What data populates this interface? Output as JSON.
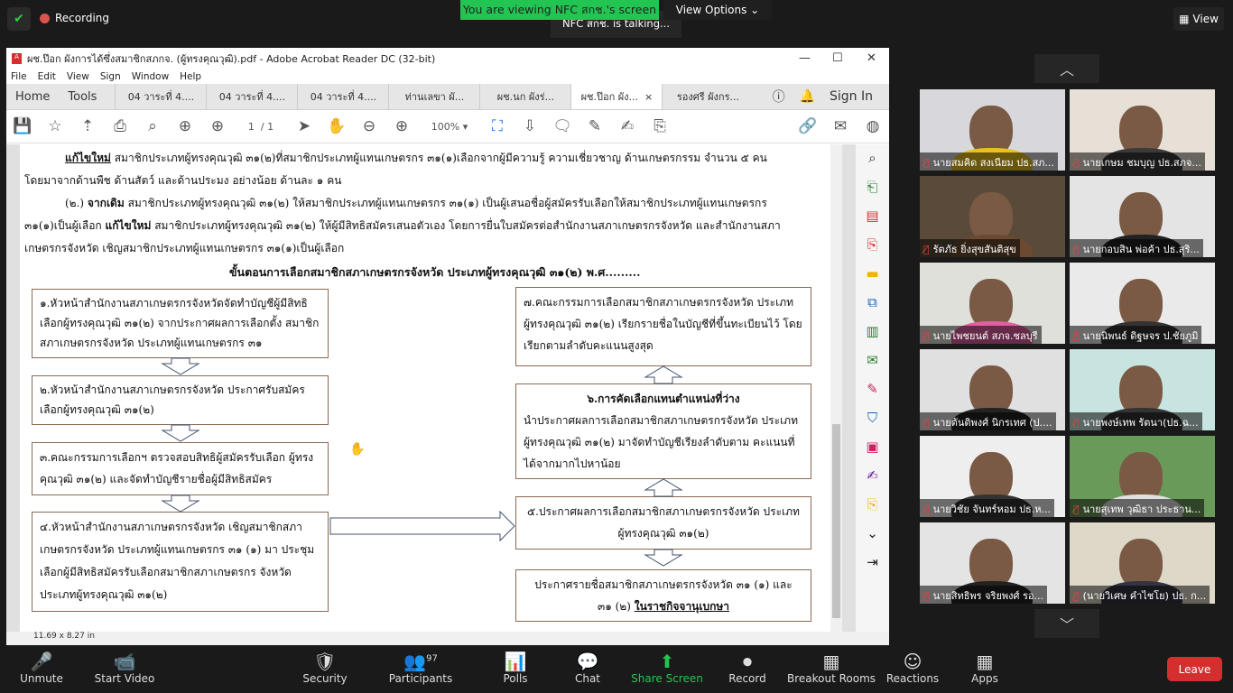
{
  "zoom": {
    "recording": "Recording",
    "viewing_banner": "You are viewing NFC สกช.'s screen",
    "view_options": "View Options",
    "talking": "NFC สกช. is talking...",
    "view": "View"
  },
  "acrobat": {
    "title": "ผช.ป๊อก ผังการได้ซึ่งสมาชิกสภกจ. (ผู้ทรงคุณวุฒิ).pdf - Adobe Acrobat Reader DC (32-bit)",
    "menu": [
      "File",
      "Edit",
      "View",
      "Sign",
      "Window",
      "Help"
    ],
    "home": "Home",
    "tools": "Tools",
    "tabs": [
      "04 วาระที่ 4....",
      "04 วาระที่ 4....",
      "04 วาระที่ 4....",
      "ท่านเลขา ผั...",
      "ผช.นก ผังร่...",
      "ผช.ป๊อก ผัง...",
      "รองศรี ผังกร..."
    ],
    "active_tab": 5,
    "sign_in": "Sign In",
    "page_current": "1",
    "page_total": "/ 1",
    "zoom_level": "100%",
    "page_size": "11.69 x 8.27 in"
  },
  "doc": {
    "para1_bold": "แก้ไขใหม่",
    "para1": " สมาชิกประเภทผู้ทรงคุณวุฒิ ๓๑(๒)ที่สมาชิกประเภทผู้แทนเกษตรกร ๓๑(๑)เลือกจากผู้มีความรู้ ความเชี่ยวชาญ ด้านเกษตรกรรม จำนวน ๕ คน",
    "para1b": "โดยมาจากด้านพืช ด้านสัตว์ และด้านประมง อย่างน้อย ด้านละ ๑ คน",
    "para2a": "(๒.) ",
    "para2_bold": "จากเดิม",
    "para2": " สมาชิกประเภทผู้ทรงคุณวุฒิ ๓๑(๒) ให้สมาชิกประเภทผู้แทนเกษตรกร ๓๑(๑) เป็นผู้เสนอชื่อผู้สมัครรับเลือกให้สมาชิกประเภทผู้แทนเกษตรกร",
    "para3a": "๓๑(๑)เป็นผู้เลือก ",
    "para3_bold": "แก้ไขใหม่",
    "para3": " สมาชิกประเภทผู้ทรงคุณวุฒิ ๓๑(๒) ให้ผู้มีสิทธิสมัครเสนอตัวเอง โดยการยื่นใบสมัครต่อสำนักงานสภาเกษตรกรจังหวัด และสำนักงานสภา",
    "para4": "เกษตรกรจังหวัด เชิญสมาชิกประเภทผู้แทนเกษตรกร ๓๑(๑)เป็นผู้เลือก",
    "heading": "ขั้นตอนการเลือกสมาชิกสภาเกษตรกรจังหวัด ประเภทผู้ทรงคุณวุฒิ ๓๑(๒) พ.ศ.........",
    "step1": "๑.หัวหน้าสำนักงานสภาเกษตรกรจังหวัดจัดทำบัญชีผู้มีสิทธิ เลือกผู้ทรงคุณวุฒิ ๓๑(๒) จากประกาศผลการเลือกตั้ง สมาชิกสภาเกษตรกรจังหวัด ประเภทผู้แทนเกษตรกร ๓๑",
    "step2": "๒.หัวหน้าสำนักงานสภาเกษตรกรจังหวัด ประกาศรับสมัคร เลือกผู้ทรงคุณวุฒิ ๓๑(๒)",
    "step3": "๓.คณะกรรมการเลือกฯ ตรวจสอบสิทธิผู้สมัครรับเลือก ผู้ทรงคุณวุฒิ ๓๑(๒) และจัดทำบัญชีรายชื่อผู้มีสิทธิสมัคร",
    "step4": "๔.หัวหน้าสำนักงานสภาเกษตรกรจังหวัด เชิญสมาชิกสภา เกษตรกรจังหวัด ประเภทผู้แทนเกษตรกร ๓๑ (๑) มา ประชุมเลือกผู้มีสิทธิสมัครรับเลือกสมาชิกสภาเกษตรกร จังหวัด ประเภทผู้ทรงคุณวุฒิ ๓๑(๒)",
    "step5": "๕.ประกาศผลการเลือกสมาชิกสภาเกษตรกรจังหวัด ประเภทผู้ทรงคุณวุฒิ ๓๑(๒)",
    "step6_title": "๖.การคัดเลือกแทนตำแหน่งที่ว่าง",
    "step6": "นำประกาศผลการเลือกสมาชิกสภาเกษตรกรจังหวัด ประเภทผู้ทรงคุณวุฒิ ๓๑(๒) มาจัดทำบัญชีเรียงลำดับตาม คะแนนที่ได้จากมากไปหาน้อย",
    "step7": "๗.คณะกรรมการเลือกสมาชิกสภาเกษตรกรจังหวัด ประเภท ผู้ทรงคุณวุฒิ ๓๑(๒) เรียกรายชื่อในบัญชีที่ขึ้นทะเบียนไว้ โดยเรียกตามลำดับคะแนนสูงสุด",
    "step8": "ประกาศรายชื่อสมาชิกสภาเกษตรกรจังหวัด ๓๑ (๑) และ",
    "step8b": "๓๑ (๒) ",
    "step8_bold": "ในราชกิจจานุเบกษา"
  },
  "participants": [
    {
      "name": "นายสมคิด สงเนียม ปธ.สภ...",
      "bg": "#d8d8dc",
      "shirt": "#e8c020"
    },
    {
      "name": "นายเกษม ชมบุญ ปธ.สภจ...",
      "bg": "#e6e0d6",
      "shirt": "#3a3a3a"
    },
    {
      "name": "รัตภัธ ยิ่งสุขสันติสุข",
      "bg": "#5a4a3a",
      "shirt": "#6a4a30"
    },
    {
      "name": "นายกอบสิน พ่อค้า ปธ.สุริ...",
      "bg": "#e4e4e4",
      "shirt": "#222222"
    },
    {
      "name": "นายไพชยนต์ สภจ.ชลบุรี",
      "bg": "#e0e0da",
      "shirt": "#e060a0"
    },
    {
      "name": "นายนิพนธ์ ดิฐษจร ป.ชัยภูมิ",
      "bg": "#eaeaea",
      "shirt": "#333333"
    },
    {
      "name": "นายตันติพงศ์ นิกรเทศ (ป....",
      "bg": "#e0e0e0",
      "shirt": "#222222"
    },
    {
      "name": "นายพงษ์เทพ รัตนา(ปธ.ฉ...",
      "bg": "#c8e4e0",
      "shirt": "#333333"
    },
    {
      "name": "นายวิชัย จันทร์หอม ปธ.ห...",
      "bg": "#eeeeee",
      "shirt": "#333333"
    },
    {
      "name": "นายสุเทพ วุฒิธา ประธาน...",
      "bg": "#6a9a5a",
      "shirt": "#e0e0e0"
    },
    {
      "name": "นายสิทธิพร  จริยพงศ์ รอ...",
      "bg": "#e4e4e4",
      "shirt": "#222222"
    },
    {
      "name": "(นายวิเศษ คำไชโย) ปธ. ก...",
      "bg": "#ddd8c8",
      "shirt": "#333344"
    }
  ],
  "toolbar": [
    {
      "label": "Unmute",
      "icon": "🎤"
    },
    {
      "label": "Start Video",
      "icon": "📹"
    },
    {
      "label": "Security",
      "icon": "🛡"
    },
    {
      "label": "Participants",
      "icon": "👥",
      "count": "97"
    },
    {
      "label": "Polls",
      "icon": "📊"
    },
    {
      "label": "Chat",
      "icon": "💬"
    },
    {
      "label": "Share Screen",
      "icon": "⬆"
    },
    {
      "label": "Record",
      "icon": "⏺"
    },
    {
      "label": "Breakout Rooms",
      "icon": "▦"
    },
    {
      "label": "Reactions",
      "icon": "☺"
    },
    {
      "label": "Apps",
      "icon": "▦"
    }
  ],
  "leave": "Leave",
  "colors": {
    "share_green": "#23c552",
    "leave_red": "#d32f2f",
    "mic_muted": "#e0443e"
  }
}
